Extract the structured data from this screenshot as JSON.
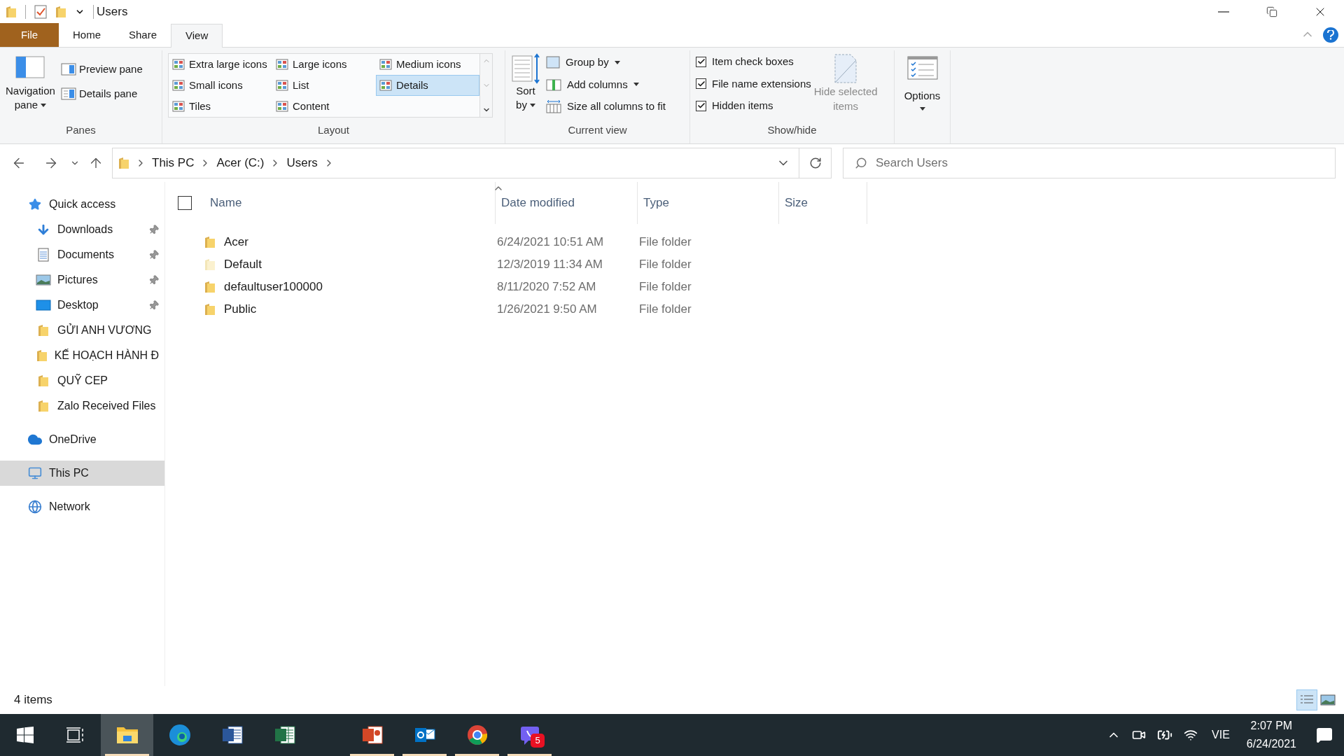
{
  "window": {
    "title": "Users"
  },
  "ribbon_tabs": [
    {
      "label": "File",
      "kind": "file",
      "selected": false
    },
    {
      "label": "Home",
      "kind": "tab",
      "selected": false
    },
    {
      "label": "Share",
      "kind": "tab",
      "selected": false
    },
    {
      "label": "View",
      "kind": "tab",
      "selected": true
    }
  ],
  "ribbon": {
    "panes": {
      "label": "Panes",
      "navigation_pane": [
        "Navigation",
        "pane"
      ],
      "preview_pane": "Preview pane",
      "details_pane": "Details pane"
    },
    "layout": {
      "label": "Layout",
      "options": [
        {
          "label": "Extra large icons",
          "selected": false
        },
        {
          "label": "Large icons",
          "selected": false
        },
        {
          "label": "Medium icons",
          "selected": false
        },
        {
          "label": "Small icons",
          "selected": false
        },
        {
          "label": "List",
          "selected": false
        },
        {
          "label": "Details",
          "selected": true
        },
        {
          "label": "Tiles",
          "selected": false
        },
        {
          "label": "Content",
          "selected": false
        }
      ]
    },
    "current_view": {
      "label": "Current view",
      "sort_by": [
        "Sort",
        "by"
      ],
      "group_by": "Group by",
      "add_columns": "Add columns",
      "size_columns": "Size all columns to fit"
    },
    "show_hide": {
      "label": "Show/hide",
      "checkboxes": [
        {
          "label": "Item check boxes",
          "checked": true
        },
        {
          "label": "File name extensions",
          "checked": true
        },
        {
          "label": "Hidden items",
          "checked": true
        }
      ],
      "hide_selected": {
        "label": [
          "Hide selected",
          "items"
        ],
        "disabled": true
      }
    },
    "options": {
      "label": "Options"
    }
  },
  "address_bar": {
    "breadcrumbs": [
      "This PC",
      "Acer (C:)",
      "Users"
    ]
  },
  "search": {
    "placeholder": "Search Users"
  },
  "navigation": [
    {
      "label": "Quick access",
      "kind": "star",
      "selected": false,
      "children": [
        {
          "label": "Downloads",
          "kind": "download",
          "pinned": true,
          "selected": false
        },
        {
          "label": "Documents",
          "kind": "document",
          "pinned": true,
          "selected": false
        },
        {
          "label": "Pictures",
          "kind": "picture",
          "pinned": true,
          "selected": false
        },
        {
          "label": "Desktop",
          "kind": "desktop",
          "pinned": true,
          "selected": false
        },
        {
          "label": "GỬI ANH VƯƠNG",
          "kind": "folder",
          "pinned": false,
          "selected": false
        },
        {
          "label": "KẾ HOẠCH HÀNH Đ",
          "kind": "folder",
          "pinned": false,
          "selected": false
        },
        {
          "label": "QUỸ CEP",
          "kind": "folder",
          "pinned": false,
          "selected": false
        },
        {
          "label": "Zalo Received Files",
          "kind": "folder",
          "pinned": false,
          "selected": false
        }
      ]
    },
    {
      "label": "OneDrive",
      "kind": "cloud",
      "selected": false
    },
    {
      "label": "This PC",
      "kind": "computer",
      "selected": true
    },
    {
      "label": "Network",
      "kind": "network",
      "selected": false
    }
  ],
  "table": {
    "select_all_checked": false,
    "columns": [
      "Name",
      "Date modified",
      "Type",
      "Size"
    ],
    "rows": [
      {
        "name": "Acer",
        "date": "6/24/2021 10:51 AM",
        "type": "File folder",
        "faded": false
      },
      {
        "name": "Default",
        "date": "12/3/2019 11:34 AM",
        "type": "File folder",
        "faded": true
      },
      {
        "name": "defaultuser100000",
        "date": "8/11/2020 7:52 AM",
        "type": "File folder",
        "faded": false
      },
      {
        "name": "Public",
        "date": "1/26/2021 9:50 AM",
        "type": "File folder",
        "faded": false
      }
    ]
  },
  "status_bar": {
    "item_count": "4 items",
    "view_buttons": [
      {
        "kind": "details",
        "selected": true
      },
      {
        "kind": "large_icons",
        "selected": false
      }
    ]
  },
  "taskbar": {
    "apps": [
      {
        "kind": "explorer",
        "active": true,
        "running": true
      },
      {
        "kind": "edge",
        "active": false,
        "running": false
      },
      {
        "kind": "word",
        "active": false,
        "running": false
      },
      {
        "kind": "excel",
        "active": false,
        "running": false
      },
      {
        "kind": "powerpoint",
        "active": false,
        "running": true
      },
      {
        "kind": "outlook",
        "active": false,
        "running": true
      },
      {
        "kind": "chrome",
        "active": false,
        "running": true
      },
      {
        "kind": "viber",
        "active": false,
        "running": true,
        "badge": "5"
      }
    ],
    "language": "VIE",
    "time": "2:07 PM",
    "date": "6/24/2021"
  }
}
